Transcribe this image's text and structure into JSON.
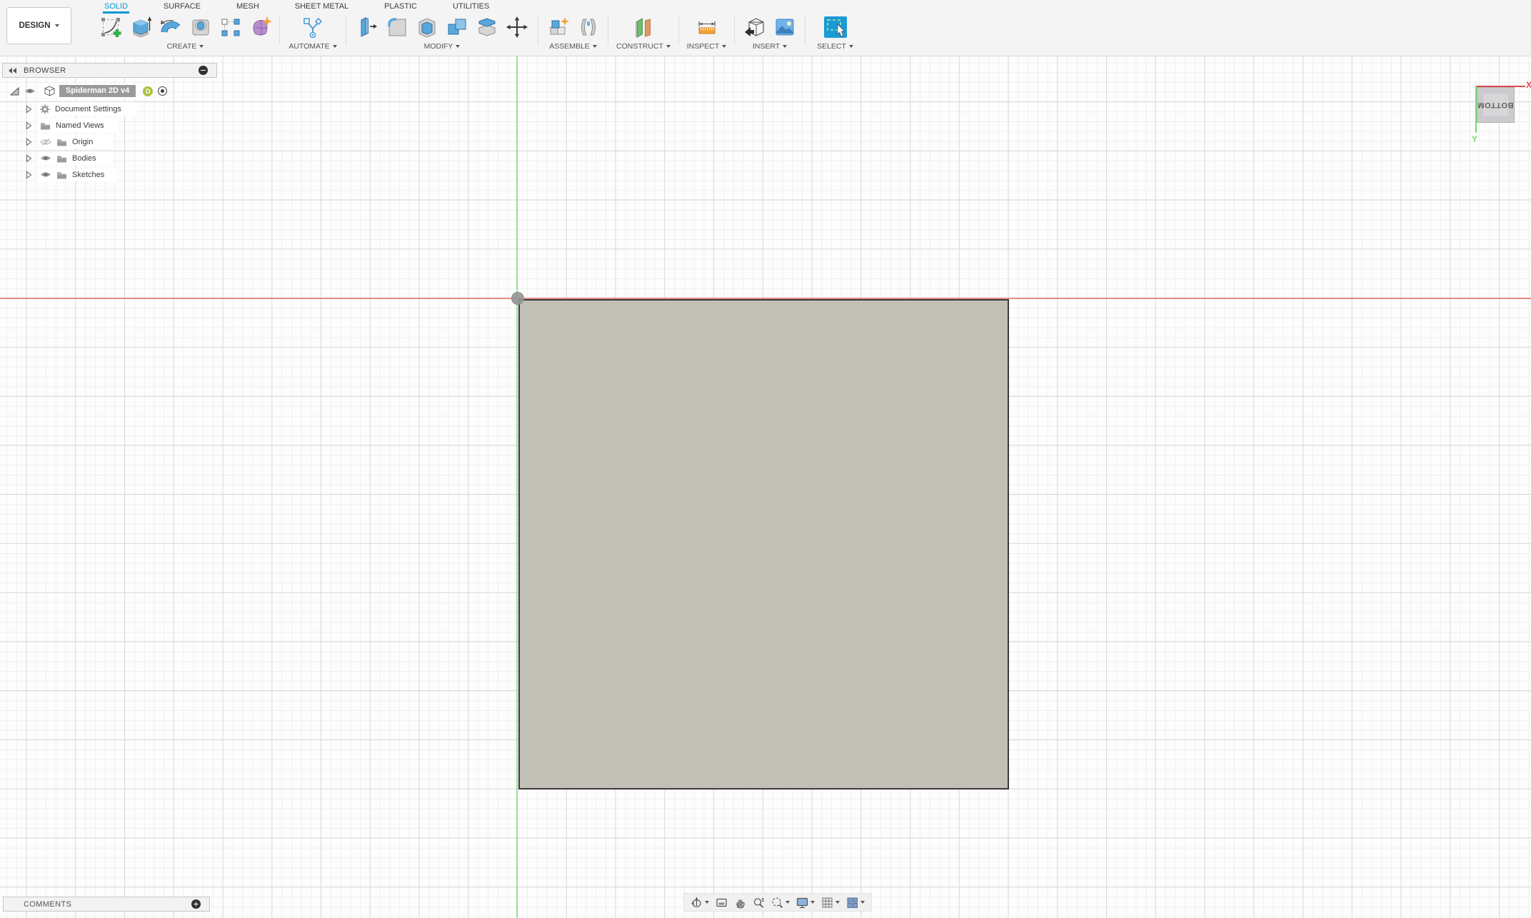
{
  "topbar": {
    "design_menu": {
      "label": "DESIGN"
    },
    "tabs": [
      {
        "label": "SOLID",
        "active": true
      },
      {
        "label": "SURFACE",
        "active": false
      },
      {
        "label": "MESH",
        "active": false
      },
      {
        "label": "SHEET METAL",
        "active": false
      },
      {
        "label": "PLASTIC",
        "active": false
      },
      {
        "label": "UTILITIES",
        "active": false
      }
    ],
    "groups": [
      {
        "label": "CREATE",
        "icons": [
          "create-sketch",
          "extrude",
          "revolve",
          "hole",
          "rectangular-pattern",
          "create-form"
        ]
      },
      {
        "label": "AUTOMATE",
        "icons": [
          "automate"
        ]
      },
      {
        "label": "MODIFY",
        "icons": [
          "press-pull",
          "fillet",
          "shell",
          "combine",
          "split-body",
          "move-copy"
        ]
      },
      {
        "label": "ASSEMBLE",
        "icons": [
          "new-component",
          "joint"
        ]
      },
      {
        "label": "CONSTRUCT",
        "icons": [
          "construction-plane"
        ]
      },
      {
        "label": "INSPECT",
        "icons": [
          "measure"
        ]
      },
      {
        "label": "INSERT",
        "icons": [
          "insert-derive",
          "canvas"
        ]
      },
      {
        "label": "SELECT",
        "icons": [
          "select"
        ]
      }
    ]
  },
  "browser": {
    "title": "BROWSER",
    "root": {
      "label": "Spiderman 2D v4",
      "badge": "D"
    },
    "items": [
      {
        "label": "Document Settings",
        "icon": "gear-icon",
        "visibility": null
      },
      {
        "label": "Named Views",
        "icon": "folder-icon",
        "visibility": null
      },
      {
        "label": "Origin",
        "icon": "folder-icon",
        "visibility": "hidden"
      },
      {
        "label": "Bodies",
        "icon": "folder-icon",
        "visibility": "visible"
      },
      {
        "label": "Sketches",
        "icon": "folder-icon",
        "visibility": "visible"
      }
    ]
  },
  "viewcube": {
    "face_label": "BOTTOM",
    "axis_x_label": "X",
    "axis_y_label": "Y",
    "x_color": "#e04b4b",
    "y_color": "#6ede6e"
  },
  "comments": {
    "label": "COMMENTS"
  },
  "nav_toolbar": {
    "items": [
      "orbit",
      "look-at",
      "pan",
      "zoom",
      "fit",
      "display-settings",
      "grid-and-snaps",
      "viewports"
    ]
  },
  "canvas": {
    "body_fill": "#c1bfb6",
    "body_border": "#3b3a36",
    "axis_x_color": "#e7675d",
    "axis_y_color": "#84db84"
  },
  "colors": {
    "accent_blue": "#0696d7",
    "toolbar_bg": "#f4f4f4",
    "canvas_bg": "#fdfdfd"
  }
}
